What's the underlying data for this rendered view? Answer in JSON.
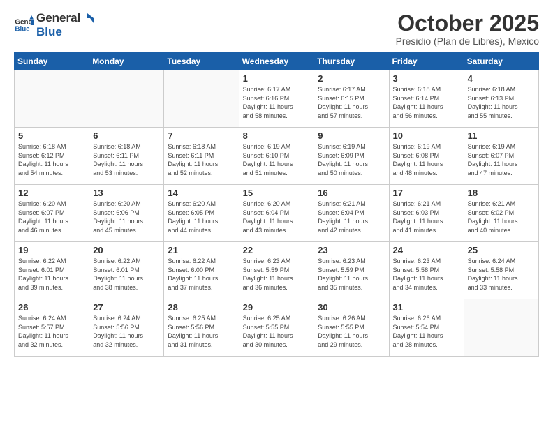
{
  "logo": {
    "general": "General",
    "blue": "Blue"
  },
  "header": {
    "month": "October 2025",
    "location": "Presidio (Plan de Libres), Mexico"
  },
  "weekdays": [
    "Sunday",
    "Monday",
    "Tuesday",
    "Wednesday",
    "Thursday",
    "Friday",
    "Saturday"
  ],
  "weeks": [
    [
      {
        "day": "",
        "info": ""
      },
      {
        "day": "",
        "info": ""
      },
      {
        "day": "",
        "info": ""
      },
      {
        "day": "1",
        "info": "Sunrise: 6:17 AM\nSunset: 6:16 PM\nDaylight: 11 hours\nand 58 minutes."
      },
      {
        "day": "2",
        "info": "Sunrise: 6:17 AM\nSunset: 6:15 PM\nDaylight: 11 hours\nand 57 minutes."
      },
      {
        "day": "3",
        "info": "Sunrise: 6:18 AM\nSunset: 6:14 PM\nDaylight: 11 hours\nand 56 minutes."
      },
      {
        "day": "4",
        "info": "Sunrise: 6:18 AM\nSunset: 6:13 PM\nDaylight: 11 hours\nand 55 minutes."
      }
    ],
    [
      {
        "day": "5",
        "info": "Sunrise: 6:18 AM\nSunset: 6:12 PM\nDaylight: 11 hours\nand 54 minutes."
      },
      {
        "day": "6",
        "info": "Sunrise: 6:18 AM\nSunset: 6:11 PM\nDaylight: 11 hours\nand 53 minutes."
      },
      {
        "day": "7",
        "info": "Sunrise: 6:18 AM\nSunset: 6:11 PM\nDaylight: 11 hours\nand 52 minutes."
      },
      {
        "day": "8",
        "info": "Sunrise: 6:19 AM\nSunset: 6:10 PM\nDaylight: 11 hours\nand 51 minutes."
      },
      {
        "day": "9",
        "info": "Sunrise: 6:19 AM\nSunset: 6:09 PM\nDaylight: 11 hours\nand 50 minutes."
      },
      {
        "day": "10",
        "info": "Sunrise: 6:19 AM\nSunset: 6:08 PM\nDaylight: 11 hours\nand 48 minutes."
      },
      {
        "day": "11",
        "info": "Sunrise: 6:19 AM\nSunset: 6:07 PM\nDaylight: 11 hours\nand 47 minutes."
      }
    ],
    [
      {
        "day": "12",
        "info": "Sunrise: 6:20 AM\nSunset: 6:07 PM\nDaylight: 11 hours\nand 46 minutes."
      },
      {
        "day": "13",
        "info": "Sunrise: 6:20 AM\nSunset: 6:06 PM\nDaylight: 11 hours\nand 45 minutes."
      },
      {
        "day": "14",
        "info": "Sunrise: 6:20 AM\nSunset: 6:05 PM\nDaylight: 11 hours\nand 44 minutes."
      },
      {
        "day": "15",
        "info": "Sunrise: 6:20 AM\nSunset: 6:04 PM\nDaylight: 11 hours\nand 43 minutes."
      },
      {
        "day": "16",
        "info": "Sunrise: 6:21 AM\nSunset: 6:04 PM\nDaylight: 11 hours\nand 42 minutes."
      },
      {
        "day": "17",
        "info": "Sunrise: 6:21 AM\nSunset: 6:03 PM\nDaylight: 11 hours\nand 41 minutes."
      },
      {
        "day": "18",
        "info": "Sunrise: 6:21 AM\nSunset: 6:02 PM\nDaylight: 11 hours\nand 40 minutes."
      }
    ],
    [
      {
        "day": "19",
        "info": "Sunrise: 6:22 AM\nSunset: 6:01 PM\nDaylight: 11 hours\nand 39 minutes."
      },
      {
        "day": "20",
        "info": "Sunrise: 6:22 AM\nSunset: 6:01 PM\nDaylight: 11 hours\nand 38 minutes."
      },
      {
        "day": "21",
        "info": "Sunrise: 6:22 AM\nSunset: 6:00 PM\nDaylight: 11 hours\nand 37 minutes."
      },
      {
        "day": "22",
        "info": "Sunrise: 6:23 AM\nSunset: 5:59 PM\nDaylight: 11 hours\nand 36 minutes."
      },
      {
        "day": "23",
        "info": "Sunrise: 6:23 AM\nSunset: 5:59 PM\nDaylight: 11 hours\nand 35 minutes."
      },
      {
        "day": "24",
        "info": "Sunrise: 6:23 AM\nSunset: 5:58 PM\nDaylight: 11 hours\nand 34 minutes."
      },
      {
        "day": "25",
        "info": "Sunrise: 6:24 AM\nSunset: 5:58 PM\nDaylight: 11 hours\nand 33 minutes."
      }
    ],
    [
      {
        "day": "26",
        "info": "Sunrise: 6:24 AM\nSunset: 5:57 PM\nDaylight: 11 hours\nand 32 minutes."
      },
      {
        "day": "27",
        "info": "Sunrise: 6:24 AM\nSunset: 5:56 PM\nDaylight: 11 hours\nand 32 minutes."
      },
      {
        "day": "28",
        "info": "Sunrise: 6:25 AM\nSunset: 5:56 PM\nDaylight: 11 hours\nand 31 minutes."
      },
      {
        "day": "29",
        "info": "Sunrise: 6:25 AM\nSunset: 5:55 PM\nDaylight: 11 hours\nand 30 minutes."
      },
      {
        "day": "30",
        "info": "Sunrise: 6:26 AM\nSunset: 5:55 PM\nDaylight: 11 hours\nand 29 minutes."
      },
      {
        "day": "31",
        "info": "Sunrise: 6:26 AM\nSunset: 5:54 PM\nDaylight: 11 hours\nand 28 minutes."
      },
      {
        "day": "",
        "info": ""
      }
    ]
  ]
}
